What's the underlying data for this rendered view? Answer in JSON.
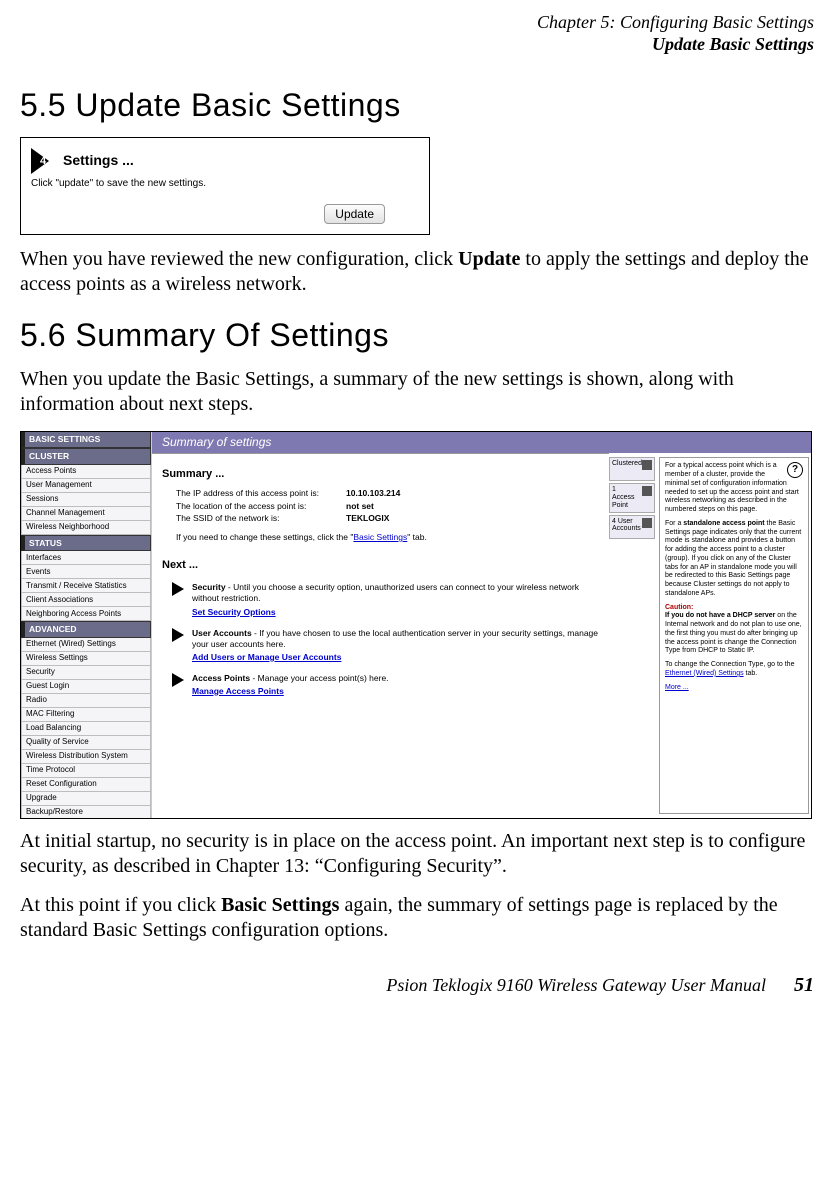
{
  "header": {
    "line1": "Chapter 5:  Configuring Basic Settings",
    "line2": "Update Basic Settings"
  },
  "section55": {
    "heading": "5.5   Update Basic Settings",
    "settings_title": "Settings ...",
    "settings_sub": "Click \"update\" to save the new settings.",
    "update_btn": "Update",
    "step_number": "4",
    "para": "When you have reviewed the new configuration, click Update to apply the settings and deploy the access points as a wireless network."
  },
  "section56": {
    "heading": "5.6   Summary Of Settings",
    "intro": "When you update the Basic Settings, a summary of the new settings is shown, along with information about next steps."
  },
  "nav": {
    "basic": "BASIC SETTINGS",
    "cluster": "CLUSTER",
    "cluster_items": [
      "Access Points",
      "User Management",
      "Sessions",
      "Channel Management",
      "Wireless Neighborhood"
    ],
    "status": "STATUS",
    "status_items": [
      "Interfaces",
      "Events",
      "Transmit / Receive Statistics",
      "Client Associations",
      "Neighboring Access Points"
    ],
    "advanced": "ADVANCED",
    "advanced_items": [
      "Ethernet (Wired) Settings",
      "Wireless Settings",
      "Security",
      "Guest Login",
      "Radio",
      "MAC Filtering",
      "Load Balancing",
      "Quality of Service",
      "Wireless Distribution System",
      "Time Protocol",
      "Reset Configuration",
      "Upgrade",
      "Backup/Restore"
    ]
  },
  "summary": {
    "titlebar": "Summary of settings",
    "h_summary": "Summary ...",
    "rows": [
      {
        "label": "The IP address of this access point is:",
        "value": "10.10.103.214"
      },
      {
        "label": "The location of the access point is:",
        "value": "not set"
      },
      {
        "label": "The SSID of the network is:",
        "value": "TEKLOGIX"
      }
    ],
    "note_pre": "If you need to change these settings, click the \"",
    "note_link": "Basic Settings",
    "note_post": "\" tab.",
    "h_next": "Next ...",
    "next_items": [
      {
        "title": "Security",
        "text": " - Until you choose a security option, unauthorized users can connect to your wireless network without restriction.",
        "link": "Set Security Options"
      },
      {
        "title": "User Accounts",
        "text": " - If you have chosen to use the local authentication server in your security settings, manage your user accounts here.",
        "link": "Add Users or Manage User Accounts"
      },
      {
        "title": "Access Points",
        "text": " - Manage your access point(s) here.",
        "link": "Manage Access Points"
      }
    ]
  },
  "status_chips": [
    {
      "label": "Clustered"
    },
    {
      "label": "1\nAccess\nPoint"
    },
    {
      "label": "4 User\nAccounts"
    }
  ],
  "help": {
    "q": "?",
    "p1": "For a typical access point which is a member of a cluster, provide the minimal set of configuration information needed to set up the access point and start wireless networking as described in the numbered steps on this page.",
    "p2a": "For a ",
    "p2b": "standalone access point",
    "p2c": " the Basic Settings page indicates only that the current mode is standalone and provides a button for adding the access point to a cluster (group). If you click on any of the Cluster tabs for an AP in standalone mode you will be redirected to this Basic Settings page because Cluster settings do not apply to standalone APs.",
    "caution_label": "Caution:",
    "p3a": "If you do not have a DHCP server",
    "p3b": " on the Internal network and do not plan to use one, the first thing you must do after bringing up the access point is change the Connection Type from DHCP to Static IP.",
    "p4a": "To change the Connection Type, go to the ",
    "p4link": "Ethernet (Wired) Settings",
    "p4b": " tab.",
    "more": "More ..."
  },
  "closing": {
    "p1": "At initial startup, no security is in place on the access point. An important next step is to configure security, as described in Chapter 13: “Configuring Security”.",
    "p2": "At this point if you click Basic Settings again, the summary of settings page is replaced by the standard Basic Settings configuration options."
  },
  "footer": {
    "title": "Psion Teklogix 9160 Wireless Gateway User Manual",
    "page": "51"
  }
}
